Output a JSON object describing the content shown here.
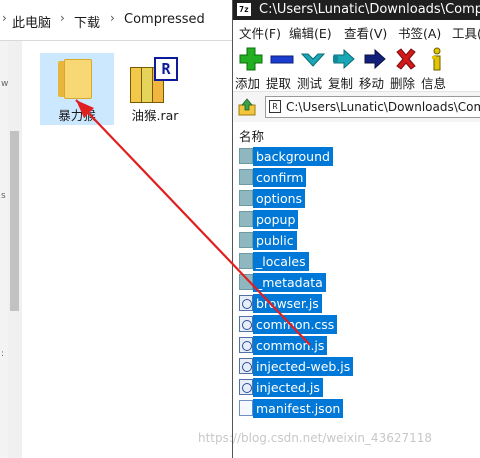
{
  "explorer": {
    "breadcrumb": [
      "此电脑",
      "下载",
      "Compressed"
    ],
    "separator": "›",
    "left_marks": [
      "w",
      "s",
      ":"
    ],
    "items": [
      {
        "name": "暴力猴",
        "type": "folder",
        "selected": true
      },
      {
        "name": "油猴.rar",
        "type": "archive",
        "selected": false,
        "badge": "R"
      }
    ]
  },
  "zip": {
    "title": "C:\\Users\\Lunatic\\Downloads\\Compres",
    "app_icon": "7z",
    "menu": [
      "文件(F)",
      "编辑(E)",
      "查看(V)",
      "书签(A)",
      "工具("
    ],
    "toolbar": [
      {
        "label": "添加",
        "icon": "plus-icon",
        "color": "#22b022"
      },
      {
        "label": "提取",
        "icon": "minus-icon",
        "color": "#1a3ccf"
      },
      {
        "label": "测试",
        "icon": "checkmark-icon",
        "color": "#1aa6b5"
      },
      {
        "label": "复制",
        "icon": "copy-arrow-icon",
        "color": "#1aa6b5"
      },
      {
        "label": "移动",
        "icon": "move-arrow-icon",
        "color": "#13207a"
      },
      {
        "label": "删除",
        "icon": "delete-x-icon",
        "color": "#d11a1a"
      },
      {
        "label": "信息",
        "icon": "info-icon",
        "color": "#e2c400"
      }
    ],
    "path": "C:\\Users\\Lunatic\\Downloads\\Com",
    "column_header": "名称",
    "files": [
      {
        "name": "background",
        "kind": "folder"
      },
      {
        "name": "confirm",
        "kind": "folder"
      },
      {
        "name": "options",
        "kind": "folder"
      },
      {
        "name": "popup",
        "kind": "folder"
      },
      {
        "name": "public",
        "kind": "folder"
      },
      {
        "name": "_locales",
        "kind": "folder"
      },
      {
        "name": "_metadata",
        "kind": "folder"
      },
      {
        "name": "browser.js",
        "kind": "script"
      },
      {
        "name": "common.css",
        "kind": "script"
      },
      {
        "name": "common.js",
        "kind": "script"
      },
      {
        "name": "injected-web.js",
        "kind": "script"
      },
      {
        "name": "injected.js",
        "kind": "script"
      },
      {
        "name": "manifest.json",
        "kind": "doc"
      }
    ]
  },
  "watermark": "https://blog.csdn.net/weixin_43627118",
  "colors": {
    "selection": "#0078d7",
    "explorer_selection": "#cce8ff",
    "arrow": "#e02020",
    "titlebar": "#1f1f1f"
  }
}
